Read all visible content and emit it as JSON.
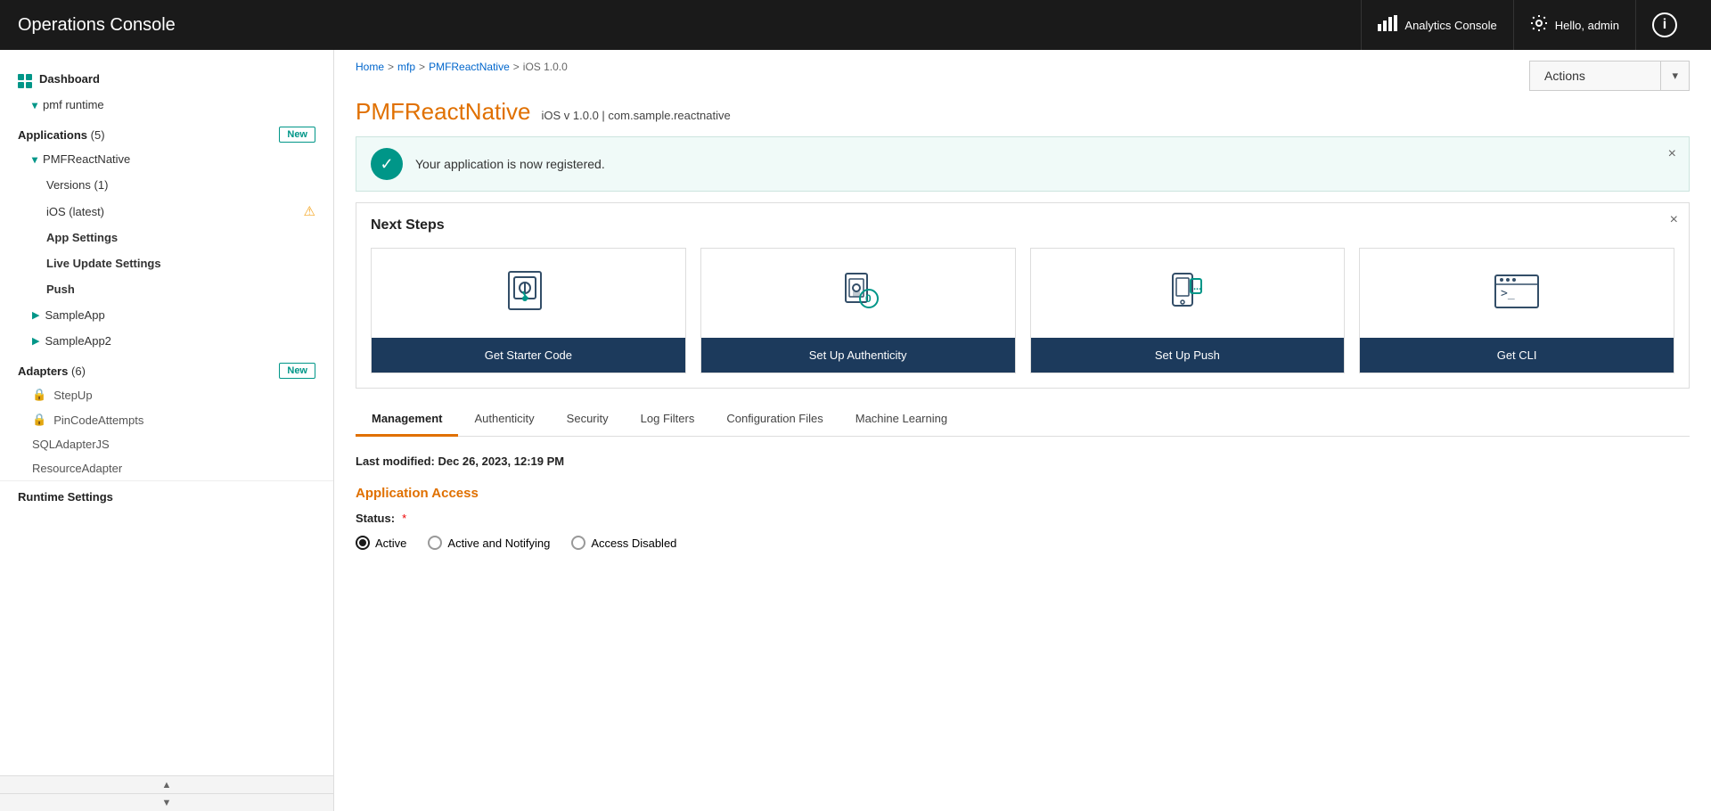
{
  "topNav": {
    "title": "Operations Console",
    "analyticsLabel": "Analytics Console",
    "userLabel": "Hello, admin",
    "infoLabel": "i"
  },
  "sidebar": {
    "dashboardLabel": "Dashboard",
    "runtimeLabel": "pmf runtime",
    "applications": {
      "label": "Applications",
      "count": "5",
      "badgeLabel": "New",
      "appName": "PMFReactNative",
      "versions": {
        "label": "Versions",
        "count": "1",
        "ios": "iOS (latest)"
      },
      "subItems": [
        "App Settings",
        "Live Update Settings",
        "Push"
      ],
      "otherApps": [
        "SampleApp",
        "SampleApp2"
      ]
    },
    "adapters": {
      "label": "Adapters",
      "count": "6",
      "badgeLabel": "New",
      "items": [
        {
          "name": "StepUp",
          "hasLock": true
        },
        {
          "name": "PinCodeAttempts",
          "hasLock": true
        },
        {
          "name": "SQLAdapterJS",
          "hasLock": false
        },
        {
          "name": "ResourceAdapter",
          "hasLock": false
        }
      ]
    },
    "runtimeSettings": "Runtime Settings"
  },
  "breadcrumb": {
    "items": [
      "Home",
      "mfp",
      "PMFReactNative",
      "iOS 1.0.0"
    ],
    "separators": [
      ">",
      ">",
      ">"
    ]
  },
  "actions": {
    "label": "Actions",
    "caretSymbol": "▾"
  },
  "appHeader": {
    "title": "PMFReactNative",
    "subtitle": "iOS v 1.0.0 | com.sample.reactnative"
  },
  "successBanner": {
    "message": "Your application is now registered.",
    "closeSymbol": "×"
  },
  "nextSteps": {
    "title": "Next Steps",
    "closeSymbol": "×",
    "cards": [
      {
        "label": "Get Starter Code"
      },
      {
        "label": "Set Up Authenticity"
      },
      {
        "label": "Set Up Push"
      },
      {
        "label": "Get CLI"
      }
    ]
  },
  "tabs": {
    "items": [
      "Management",
      "Authenticity",
      "Security",
      "Log Filters",
      "Configuration Files",
      "Machine Learning"
    ],
    "activeIndex": 0
  },
  "management": {
    "lastModified": "Last modified: Dec 26, 2023, 12:19 PM",
    "applicationAccess": {
      "sectionTitle": "Application Access",
      "statusLabel": "Status:",
      "requiredStar": "*",
      "radioOptions": [
        "Active",
        "Active and Notifying",
        "Access Disabled"
      ],
      "selectedIndex": 0
    }
  }
}
